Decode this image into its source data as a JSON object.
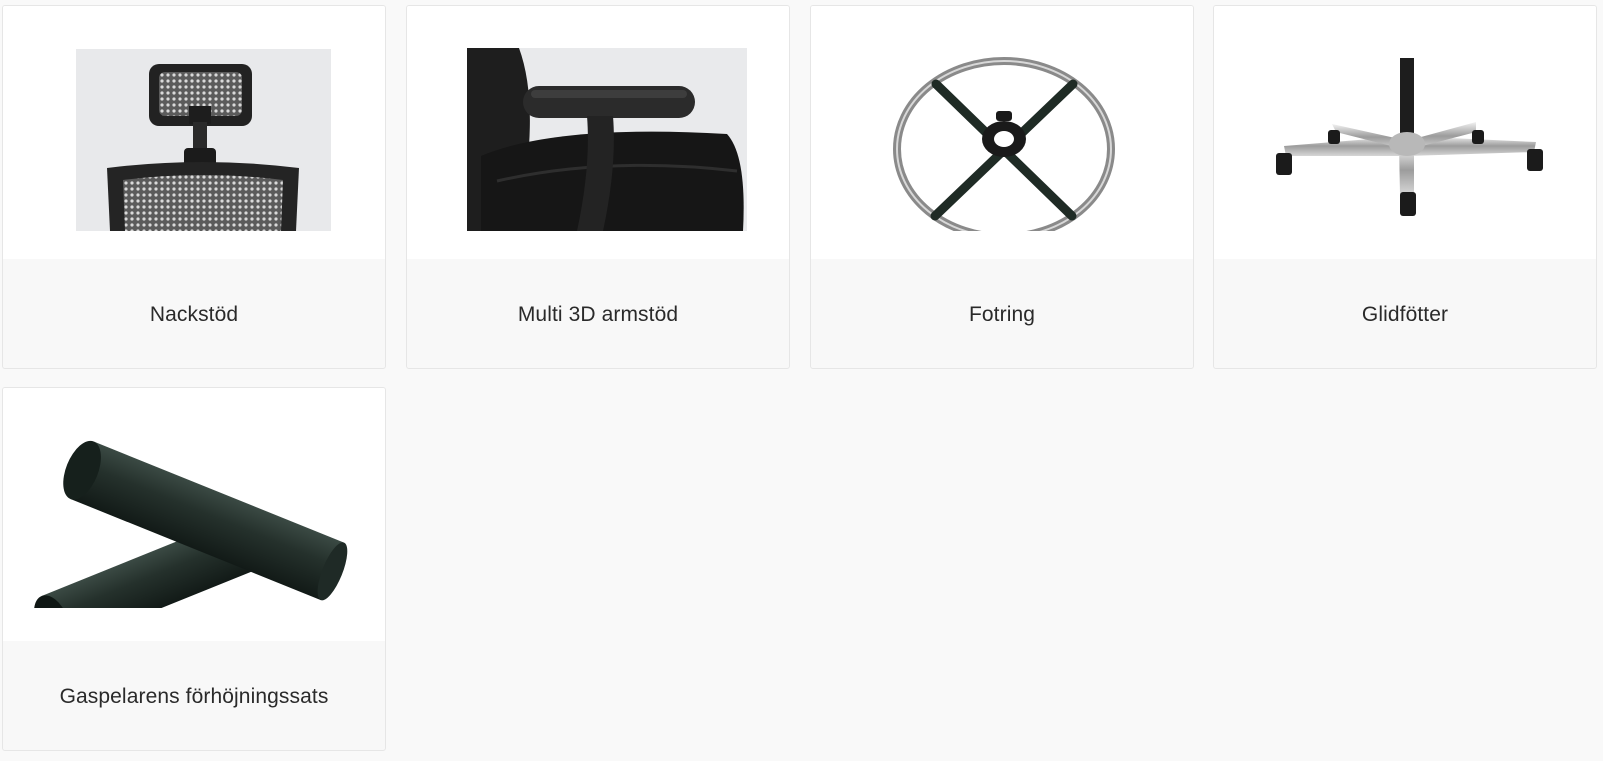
{
  "products": [
    {
      "label": "Nackstöd",
      "image_icon": "headrest-image"
    },
    {
      "label": "Multi 3D armstöd",
      "image_icon": "armrest-image"
    },
    {
      "label": "Fotring",
      "image_icon": "foot-ring-image"
    },
    {
      "label": "Glidfötter",
      "image_icon": "glides-image"
    },
    {
      "label": "Gaspelarens förhöjningssats",
      "image_icon": "gas-lift-extension-image"
    }
  ]
}
